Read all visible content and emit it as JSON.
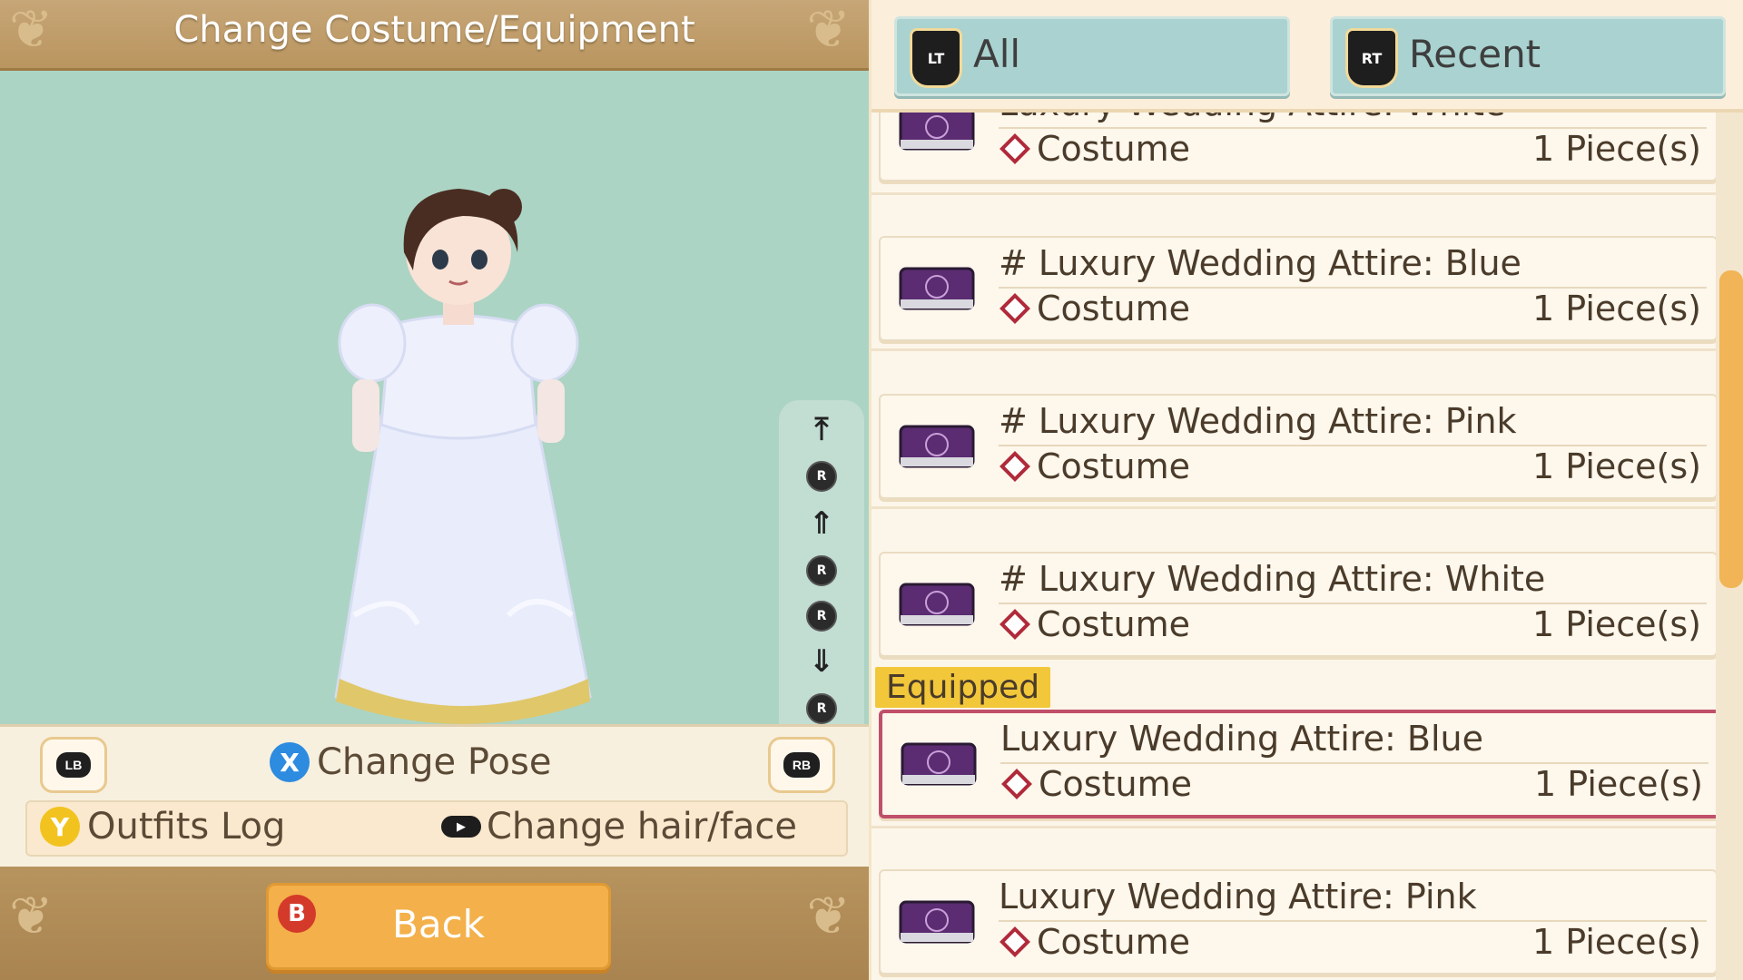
{
  "title": "Change Costume/Equipment",
  "controls": {
    "lb": "LB",
    "rb": "RB",
    "x_button": "X",
    "change_pose": "Change Pose",
    "y_button": "Y",
    "outfits_log": "Outfits Log",
    "change_hair_face": "Change hair/face",
    "b_button": "B",
    "back": "Back"
  },
  "camera_controls": [
    "top-icon",
    "r-up-icon",
    "zoom-up-icon",
    "r-left-icon",
    "r-right-icon",
    "zoom-down-icon",
    "r-down-icon",
    "bottom-icon"
  ],
  "tabs": [
    {
      "trigger": "LT",
      "label": "All"
    },
    {
      "trigger": "RT",
      "label": "Recent"
    }
  ],
  "list": {
    "partial_item": {
      "name": "Luxury Wedding Attire: White",
      "category": "Costume",
      "qty": "1 Piece(s)"
    },
    "items": [
      {
        "name": "# Luxury Wedding Attire: Blue",
        "category": "Costume",
        "qty": "1 Piece(s)"
      },
      {
        "name": "# Luxury Wedding Attire: Pink",
        "category": "Costume",
        "qty": "1 Piece(s)"
      },
      {
        "name": "# Luxury Wedding Attire: White",
        "category": "Costume",
        "qty": "1 Piece(s)"
      }
    ],
    "equipped_label": "Equipped",
    "equipped_items": [
      {
        "name": "Luxury Wedding Attire: Blue",
        "category": "Costume",
        "qty": "1 Piece(s)"
      },
      {
        "name": "Luxury Wedding Attire: Pink",
        "category": "Costume",
        "qty": "1 Piece(s)"
      }
    ]
  },
  "colors": {
    "viewport_bg": "#acd4c4",
    "tab_bg": "#a9d2d0",
    "equipped_tag": "#f2c73a",
    "equipped_border": "#c0506a",
    "back_button": "#f4b04a",
    "scroll_thumb": "#f1b456"
  }
}
